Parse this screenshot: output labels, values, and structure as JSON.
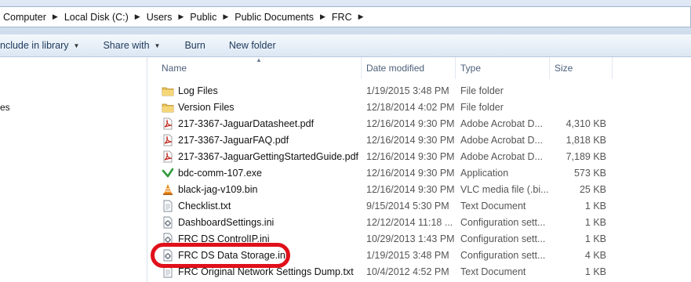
{
  "breadcrumb": [
    "Computer",
    "Local Disk (C:)",
    "Users",
    "Public",
    "Public Documents",
    "FRC"
  ],
  "toolbar": {
    "include_library": "nclude in library",
    "share_with": "Share with",
    "burn": "Burn",
    "new_folder": "New folder"
  },
  "nav": {
    "partial_item": "es"
  },
  "columns": {
    "name": "Name",
    "date": "Date modified",
    "type": "Type",
    "size": "Size"
  },
  "files": [
    {
      "name": "Log Files",
      "date": "1/19/2015 3:48 PM",
      "type": "File folder",
      "size": "",
      "icon": "folder-icon"
    },
    {
      "name": "Version Files",
      "date": "12/18/2014 4:02 PM",
      "type": "File folder",
      "size": "",
      "icon": "folder-icon"
    },
    {
      "name": "217-3367-JaguarDatasheet.pdf",
      "date": "12/16/2014 9:30 PM",
      "type": "Adobe Acrobat D...",
      "size": "4,310 KB",
      "icon": "pdf-icon"
    },
    {
      "name": "217-3367-JaguarFAQ.pdf",
      "date": "12/16/2014 9:30 PM",
      "type": "Adobe Acrobat D...",
      "size": "1,818 KB",
      "icon": "pdf-icon"
    },
    {
      "name": "217-3367-JaguarGettingStartedGuide.pdf",
      "date": "12/16/2014 9:30 PM",
      "type": "Adobe Acrobat D...",
      "size": "7,189 KB",
      "icon": "pdf-icon"
    },
    {
      "name": "bdc-comm-107.exe",
      "date": "12/16/2014 9:30 PM",
      "type": "Application",
      "size": "573 KB",
      "icon": "exe-check-icon"
    },
    {
      "name": "black-jag-v109.bin",
      "date": "12/16/2014 9:30 PM",
      "type": "VLC media file (.bi...",
      "size": "25 KB",
      "icon": "vlc-cone-icon"
    },
    {
      "name": "Checklist.txt",
      "date": "9/15/2014 5:30 PM",
      "type": "Text Document",
      "size": "1 KB",
      "icon": "text-file-icon"
    },
    {
      "name": "DashboardSettings.ini",
      "date": "12/12/2014 11:18 ...",
      "type": "Configuration sett...",
      "size": "1 KB",
      "icon": "config-file-icon"
    },
    {
      "name": "FRC DS ControlIP.ini",
      "date": "10/29/2013 1:43 PM",
      "type": "Configuration sett...",
      "size": "1 KB",
      "icon": "config-file-icon"
    },
    {
      "name": "FRC DS Data Storage.ini",
      "date": "1/19/2015 3:48 PM",
      "type": "Configuration sett...",
      "size": "4 KB",
      "icon": "config-file-icon"
    },
    {
      "name": "FRC Original Network Settings Dump.txt",
      "date": "10/4/2012 4:52 PM",
      "type": "Text Document",
      "size": "1 KB",
      "icon": "text-file-icon"
    }
  ],
  "colors": {
    "highlight": "#e0101a",
    "folder": "#e8c25a",
    "pdf": "#c0251b",
    "check": "#2f9b3a",
    "vlc": "#f08a17"
  }
}
